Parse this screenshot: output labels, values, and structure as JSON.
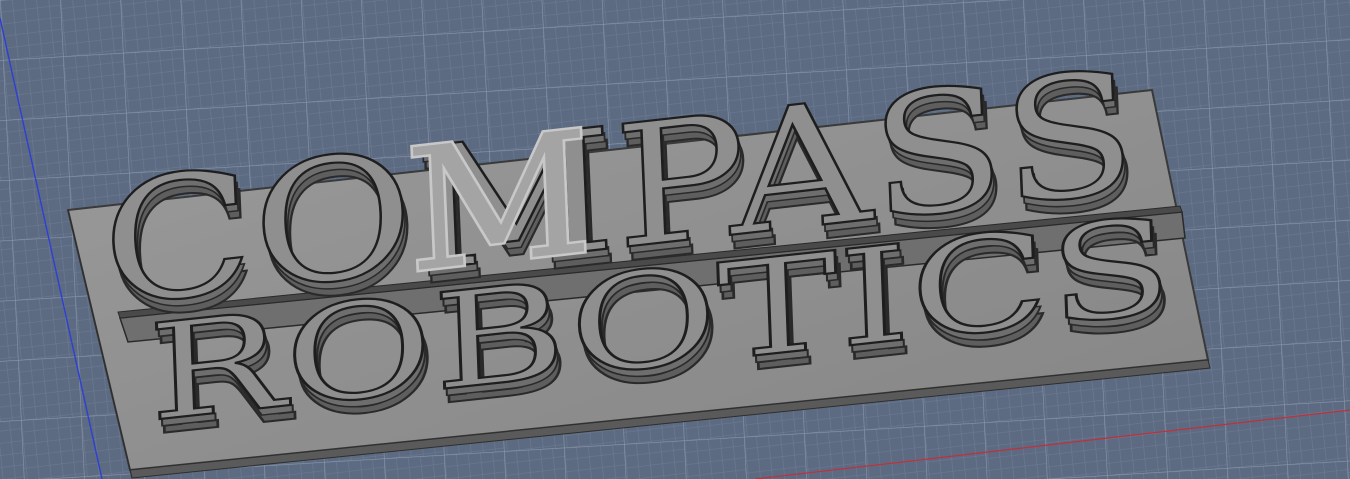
{
  "viewport": {
    "background": "#5d6b82",
    "grid_minor_color": "#74829a",
    "grid_major_color": "#8b98ad",
    "x_axis_color": "#c0303a",
    "y_axis_color": "#2e3fd6"
  },
  "model": {
    "plate_color": "#8e8e8e",
    "plate_edge_color": "#3a3a3a",
    "letter_face_color": "#8f8f8f",
    "letter_side_color": "#6e6e6e",
    "selected_letter_highlight": "#c8c8c8",
    "line1": "COMPASS",
    "line2": "ROBOTICS",
    "line1_letters": [
      "C",
      "O",
      "M",
      "P",
      "A",
      "S",
      "S"
    ],
    "line2_letters": [
      "R",
      "O",
      "B",
      "O",
      "T",
      "I",
      "C",
      "S"
    ],
    "selected_letter": "M"
  }
}
